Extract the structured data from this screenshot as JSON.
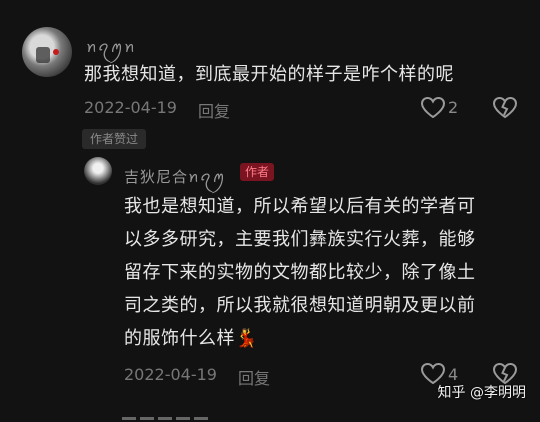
{
  "comments": [
    {
      "username": "ꪀꪖꪑꪀ",
      "text_lines": [
        "那我想知道，到底最开始的样子是咋个样的呢"
      ],
      "date": "2022-04-19",
      "reply_label": "回复",
      "like_count": "2",
      "liked_badge": "作者赞过"
    },
    {
      "username": "吉狄尼合ꪀꪖꪑ",
      "author_badge": "作者",
      "text_lines": [
        "我也是想知道，所以希望以后有关的学者可",
        "以多多研究，主要我们彝族实行火葬，能够",
        "留存下来的实物的文物都比较少，除了像土",
        "司之类的，所以我就很想知道明朝及更以前",
        "的服饰什么样"
      ],
      "emoji": "💃",
      "date": "2022-04-19",
      "reply_label": "回复",
      "like_count": "4"
    }
  ],
  "watermark": "知乎 @李明明",
  "icons": {
    "like": "heart-outline-icon",
    "dislike": "heart-broken-icon"
  },
  "colors": {
    "background": "#121212",
    "text": "#e6e6e6",
    "meta": "#777777",
    "author_badge_bg": "#7a1420",
    "author_badge_text": "#ff7a8a"
  }
}
